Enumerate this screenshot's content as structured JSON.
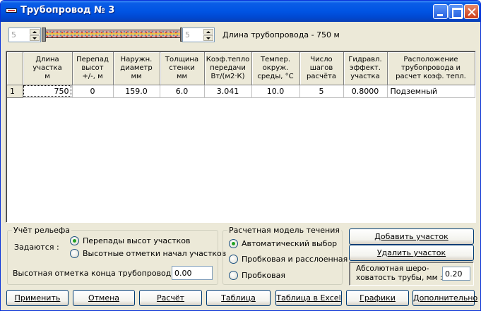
{
  "window": {
    "title": "Трубопровод № 3"
  },
  "toolbar": {
    "spin_left_value": "5",
    "spin_right_value": "5",
    "length_label": "Длина трубопровода -  750 м"
  },
  "table": {
    "headers": [
      "",
      "Длина\nучастка\nм",
      "Перепад\nвысот\n+/-, м",
      "Наружн.\nдиаметр\nмм",
      "Толщина\nстенки\nмм",
      "Коэф.тепло\nпередачи\nВт/(м2·К)",
      "Темпер.\nокруж.\nсреды, °С",
      "Число\nшагов\nрасчёта",
      "Гидравл.\nэффект.\nучастка",
      "Расположение\nтрубопровода и\nрасчет коэф. тепл."
    ],
    "rows": [
      [
        "1",
        "750",
        "0",
        "159.0",
        "6.0",
        "3.041",
        "10.0",
        "5",
        "0.8000",
        "Подземный"
      ]
    ]
  },
  "relief": {
    "legend": "Учёт рельефа",
    "set_label": "Задаются :",
    "option_diffs": "Перепады высот участков",
    "option_marks": "Высотные отметки начал участков",
    "end_mark_label": "Высотная отметка конца трубопровода, м :",
    "end_mark_value": "0.00"
  },
  "flow_model": {
    "legend": "Расчетная модель течения",
    "option_auto": "Автоматический выбор",
    "option_plug_strat": "Пробковая и расслоенная",
    "option_plug": "Пробковая"
  },
  "side": {
    "add_section": "Добавить участок",
    "delete_section": "Удалить участок",
    "roughness_label": "Абсолютная шеро-\nховатость трубы, мм :",
    "roughness_value": "0.20"
  },
  "buttons": {
    "apply": "Применить",
    "cancel": "Отмена",
    "calculate": "Расчёт",
    "table": "Таблица",
    "excel": "Таблица в Excel",
    "graphs": "Графики",
    "more": "Дополнительно"
  }
}
